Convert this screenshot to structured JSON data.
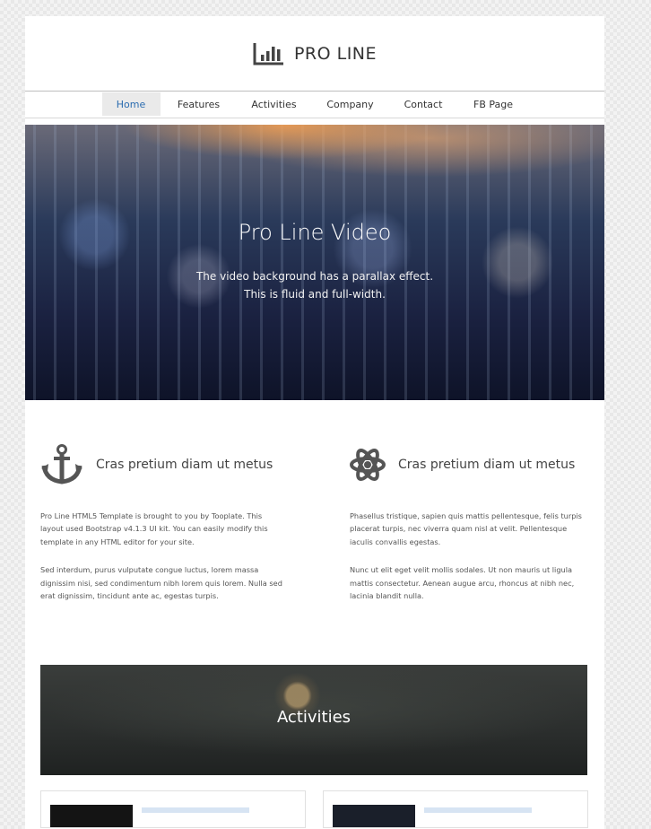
{
  "site": {
    "title": "PRO LINE",
    "logo_icon": "bar-chart-icon"
  },
  "nav": {
    "items": [
      {
        "label": "Home",
        "active": true
      },
      {
        "label": "Features",
        "active": false
      },
      {
        "label": "Activities",
        "active": false
      },
      {
        "label": "Company",
        "active": false
      },
      {
        "label": "Contact",
        "active": false
      },
      {
        "label": "FB Page",
        "active": false
      }
    ]
  },
  "hero": {
    "title": "Pro Line Video",
    "line1": "The video background has a parallax effect.",
    "line2": "This is fluid and full-width."
  },
  "features": [
    {
      "icon": "anchor-icon",
      "title": "Cras pretium diam ut metus",
      "p1": "Pro Line HTML5 Template is brought to you by Tooplate. This layout used Bootstrap v4.1.3 UI kit. You can easily modify this template in any HTML editor for your site.",
      "p2": "Sed interdum, purus vulputate congue luctus, lorem massa dignissim nisi, sed condimentum nibh lorem quis lorem. Nulla sed erat dignissim, tincidunt ante ac, egestas turpis."
    },
    {
      "icon": "atom-icon",
      "title": "Cras pretium diam ut metus",
      "p1": "Phasellus tristique, sapien quis mattis pellentesque, felis turpis placerat turpis, nec viverra quam nisl at velit. Pellentesque iaculis convallis egestas.",
      "p2": "Nunc ut elit eget velit mollis sodales. Ut non mauris ut ligula mattis consectetur. Aenean augue arcu, rhoncus at nibh nec, lacinia blandit nulla."
    }
  ],
  "activities": {
    "title": "Activities"
  },
  "colors": {
    "accent": "#2b6cb0",
    "nav_active_bg": "#eaeaea",
    "text": "#555555"
  }
}
